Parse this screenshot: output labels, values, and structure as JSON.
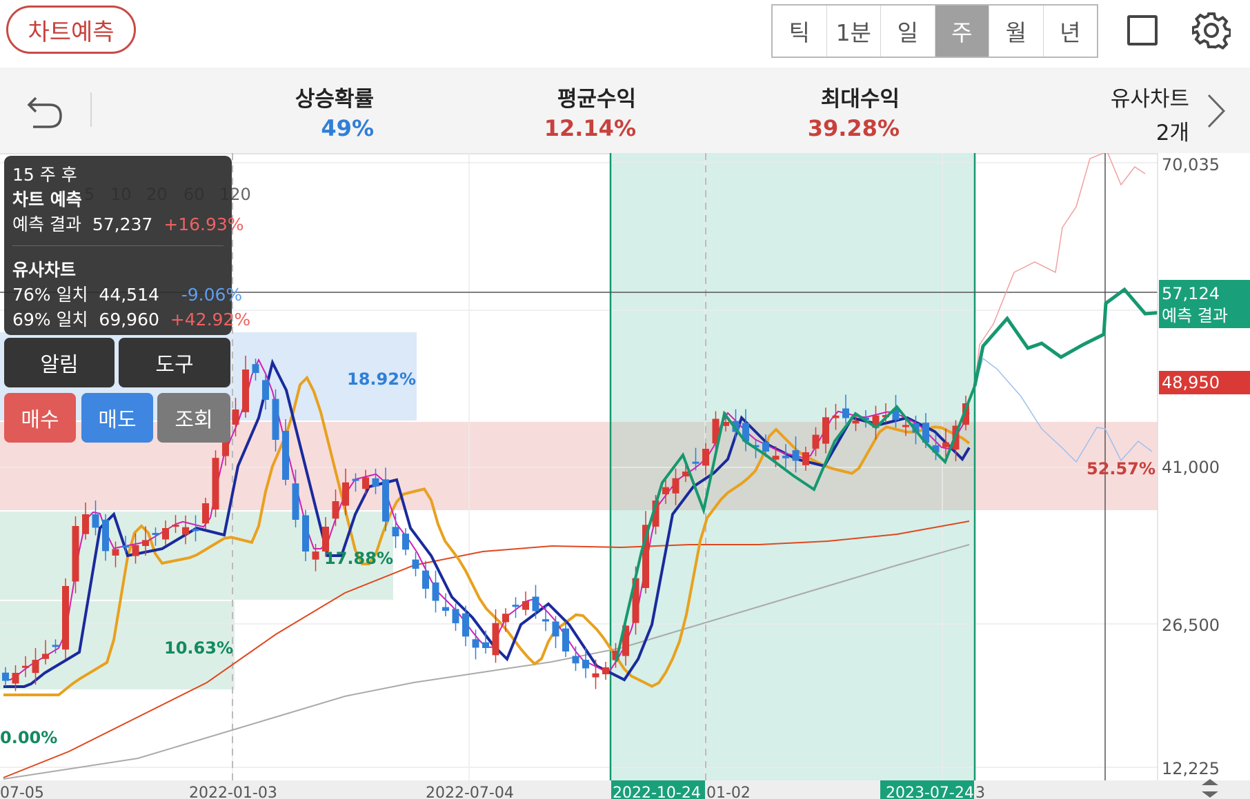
{
  "header": {
    "predict_button": "차트예측",
    "periods": [
      "틱",
      "1분",
      "일",
      "주",
      "월",
      "년"
    ],
    "active_period": "주"
  },
  "stats": {
    "rise_prob": {
      "label": "상승확률",
      "value": "49%",
      "color": "#2f7fd8"
    },
    "avg_return": {
      "label": "평균수익",
      "value": "12.14%",
      "color": "#c8413c"
    },
    "max_return": {
      "label": "최대수익",
      "value": "39.28%",
      "color": "#c8413c"
    },
    "similar_charts": {
      "label": "유사차트",
      "value": "2개"
    }
  },
  "info_panel": {
    "weeks_after": "15 주 후",
    "title": "차트 예측",
    "result_label": "예측 결과",
    "result_value": "57,237",
    "result_change": "+16.93%",
    "similar_title": "유사차트",
    "similar": [
      {
        "match": "76% 일치",
        "value": "44,514",
        "change": "-9.06%"
      },
      {
        "match": "69% 일치",
        "value": "69,960",
        "change": "+42.92%"
      }
    ]
  },
  "ma_legend": [
    "5",
    "10",
    "20",
    "60",
    "120"
  ],
  "panel_buttons": {
    "alarm": "알림",
    "tool": "도구",
    "buy": "매수",
    "sell": "매도",
    "view": "조회"
  },
  "chart_data": {
    "type": "candlestick",
    "y_axis_labels": [
      "70,035",
      "41,000",
      "26,500",
      "12,225"
    ],
    "x_axis_labels": [
      "07-05",
      "2022-01-03",
      "2022-07-04",
      "2022-10-24",
      "01-02",
      "2023-07-24",
      "3"
    ],
    "price_tags": [
      {
        "value": "57,124",
        "note": "예측 결과",
        "color": "#19a07a"
      },
      {
        "value": "48,950",
        "color": "#d93a35"
      }
    ],
    "zone_labels": [
      "18.92%",
      "17.88%",
      "10.63%",
      "0.00%",
      "52.57%"
    ],
    "colors": {
      "up": "#d93a35",
      "down": "#2f7fd8",
      "ma5": "#d21fb4",
      "ma10": "#1a2a9c",
      "ma20": "#e8a11f",
      "ma60": "#e0471e",
      "ma120": "#aaaaaa",
      "prediction": "#16986f",
      "similar_up": "#f0a0a0",
      "similar_down": "#9ec0ea"
    }
  }
}
